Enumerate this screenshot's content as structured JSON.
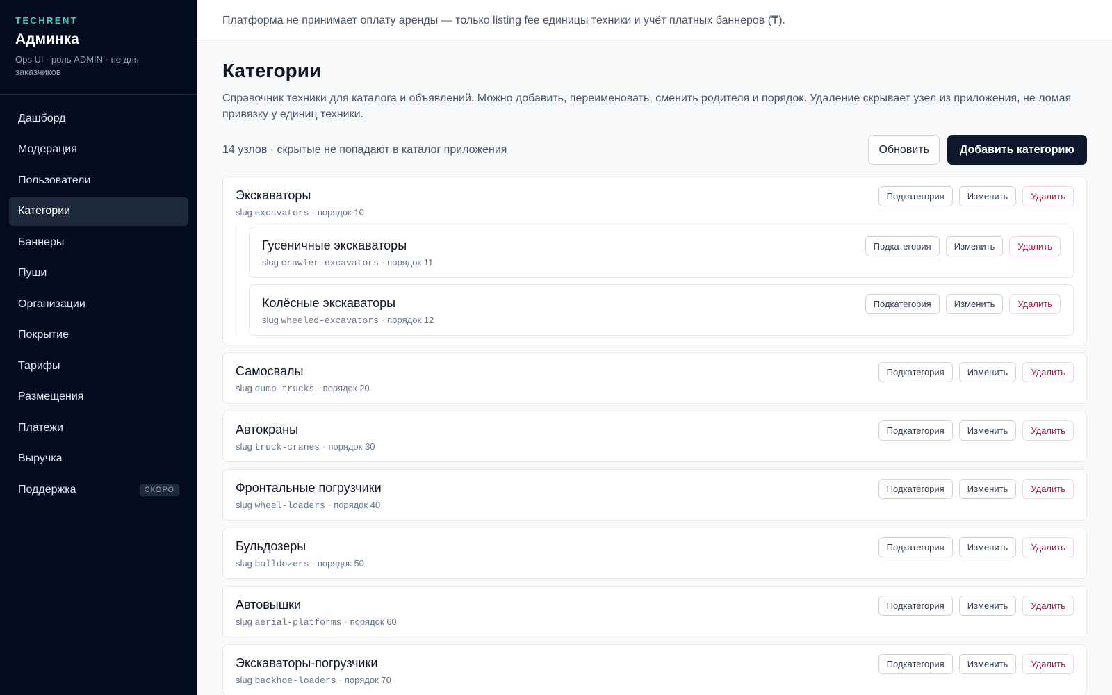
{
  "sidebar": {
    "brand_tag": "TECHRENT",
    "title": "Админка",
    "subtitle": "Ops UI · роль ADMIN · не для заказчиков",
    "items": [
      {
        "label": "Дашборд",
        "active": false
      },
      {
        "label": "Модерация",
        "active": false
      },
      {
        "label": "Пользователи",
        "active": false
      },
      {
        "label": "Категории",
        "active": true
      },
      {
        "label": "Баннеры",
        "active": false
      },
      {
        "label": "Пуши",
        "active": false
      },
      {
        "label": "Организации",
        "active": false
      },
      {
        "label": "Покрытие",
        "active": false
      },
      {
        "label": "Тарифы",
        "active": false
      },
      {
        "label": "Размещения",
        "active": false
      },
      {
        "label": "Платежи",
        "active": false
      },
      {
        "label": "Выручка",
        "active": false
      },
      {
        "label": "Поддержка",
        "active": false,
        "badge": "СКОРО"
      }
    ]
  },
  "notice": "Платформа не принимает оплату аренды — только listing fee единицы техники и учёт платных баннеров (₸).",
  "page": {
    "title": "Категории",
    "description": "Справочник техники для каталога и объявлений. Можно добавить, переименовать, сменить родителя и порядок. Удаление скрывает узел из приложения, не ломая привязку у единиц техники.",
    "count_text": "14 узлов · скрытые не попадают в каталог приложения",
    "refresh_label": "Обновить",
    "add_label": "Добавить категорию"
  },
  "labels": {
    "slug": "slug",
    "order": "порядок",
    "subcategory": "Подкатегория",
    "edit": "Изменить",
    "delete": "Удалить"
  },
  "categories": [
    {
      "name": "Экскаваторы",
      "slug": "excavators",
      "order": 10,
      "children": [
        {
          "name": "Гусеничные экскаваторы",
          "slug": "crawler-excavators",
          "order": 11
        },
        {
          "name": "Колёсные экскаваторы",
          "slug": "wheeled-excavators",
          "order": 12
        }
      ]
    },
    {
      "name": "Самосвалы",
      "slug": "dump-trucks",
      "order": 20,
      "children": []
    },
    {
      "name": "Автокраны",
      "slug": "truck-cranes",
      "order": 30,
      "children": []
    },
    {
      "name": "Фронтальные погрузчики",
      "slug": "wheel-loaders",
      "order": 40,
      "children": []
    },
    {
      "name": "Бульдозеры",
      "slug": "bulldozers",
      "order": 50,
      "children": []
    },
    {
      "name": "Автовышки",
      "slug": "aerial-platforms",
      "order": 60,
      "children": []
    },
    {
      "name": "Экскаваторы-погрузчики",
      "slug": "backhoe-loaders",
      "order": 70,
      "children": []
    }
  ]
}
